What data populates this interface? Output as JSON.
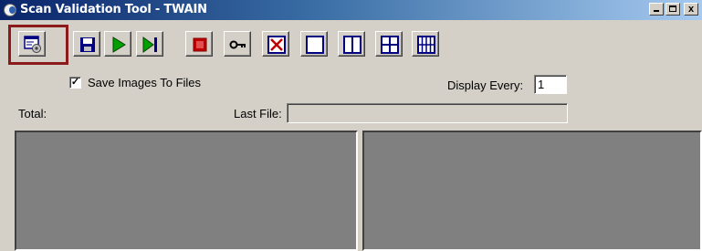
{
  "window": {
    "title": "Scan Validation Tool - TWAIN"
  },
  "caption_buttons": {
    "minimize": "_",
    "maximize": "□",
    "close": "x"
  },
  "toolbar": {
    "buttons": [
      {
        "name": "setup",
        "icon": "setup-dialog-icon"
      },
      {
        "name": "save",
        "icon": "floppy-disk-icon"
      },
      {
        "name": "start-scan",
        "icon": "play-icon"
      },
      {
        "name": "scan-one-page",
        "icon": "step-forward-icon"
      },
      {
        "name": "stop-scan",
        "icon": "stop-icon"
      },
      {
        "name": "license-key",
        "icon": "key-icon"
      },
      {
        "name": "no-images",
        "icon": "no-images-icon"
      },
      {
        "name": "one-image",
        "icon": "single-pane-icon"
      },
      {
        "name": "two-images",
        "icon": "two-pane-icon"
      },
      {
        "name": "four-images",
        "icon": "four-pane-icon"
      },
      {
        "name": "eight-images",
        "icon": "eight-pane-icon"
      }
    ],
    "highlight_color": "#8b1a1a"
  },
  "options": {
    "save_images": {
      "checked": true,
      "check_mark": "✓",
      "label": "Save Images To Files"
    },
    "display_every": {
      "label": "Display Every:",
      "value": "1"
    }
  },
  "status": {
    "total_label": "Total:",
    "last_file_label": "Last File:",
    "last_file_value": ""
  },
  "colors": {
    "title_bar_start": "#0a246a",
    "title_bar_end": "#a6caf0",
    "face": "#d4d0c8",
    "preview_background": "#808080",
    "icon_navy": "#000080",
    "icon_green": "#00a000",
    "icon_red": "#c00000"
  }
}
